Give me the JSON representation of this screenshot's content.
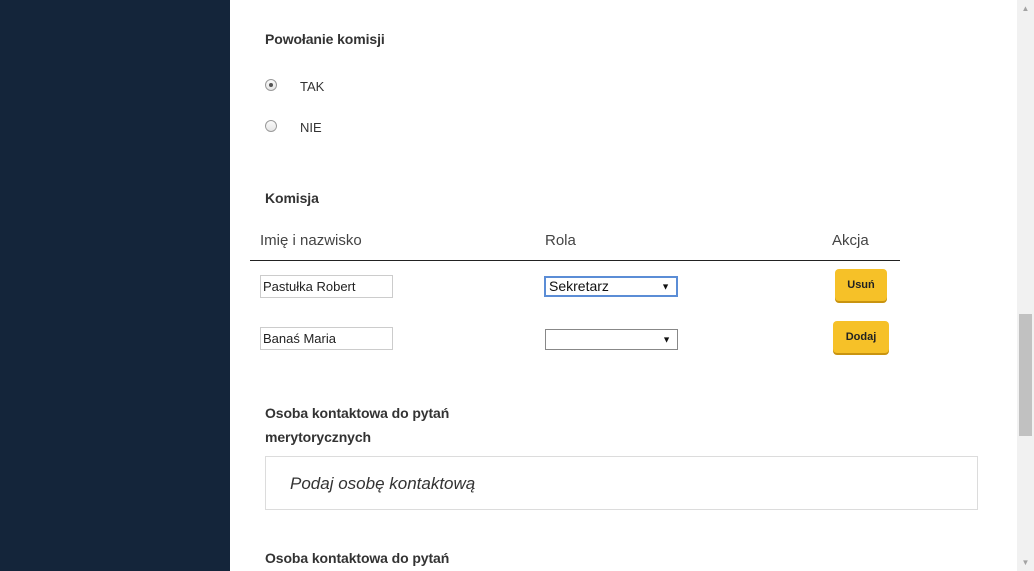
{
  "section_commission_appointment": {
    "title": "Powołanie komisji",
    "options": [
      {
        "label": "TAK",
        "checked": true
      },
      {
        "label": "NIE",
        "checked": false
      }
    ]
  },
  "commission": {
    "title": "Komisja",
    "columns": [
      "Imię i nazwisko",
      "Rola",
      "Akcja"
    ],
    "rows": [
      {
        "name": "Pastułka Robert",
        "role": "Sekretarz",
        "action": "Usuń"
      },
      {
        "name": "Banaś Maria",
        "role": "",
        "action": "Dodaj"
      }
    ]
  },
  "contact_substantive": {
    "title_line1": "Osoba kontaktowa do pytań",
    "title_line2": "merytorycznych",
    "placeholder": "Podaj osobę kontaktową"
  },
  "contact_next": {
    "title_line1": "Osoba kontaktowa do pytań"
  },
  "colors": {
    "sidebar": "#14253a",
    "accent_button": "#f6c128"
  }
}
